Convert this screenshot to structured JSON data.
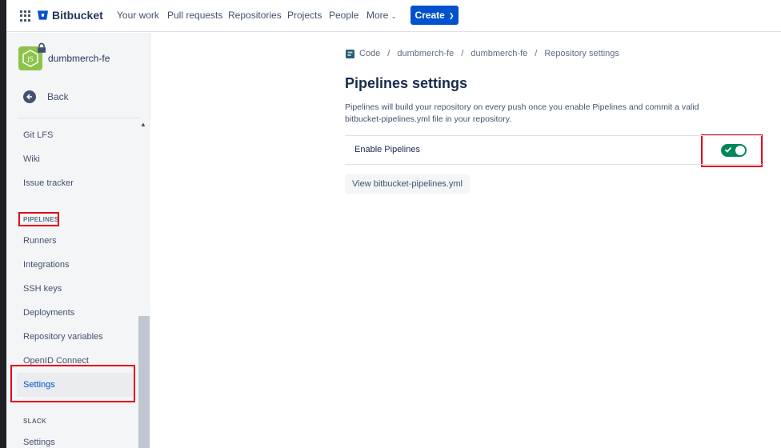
{
  "topnav": {
    "app_name": "Bitbucket",
    "items": [
      "Your work",
      "Pull requests",
      "Repositories",
      "Projects",
      "People",
      "More"
    ],
    "create_label": "Create",
    "brand_color": "#0052cc"
  },
  "sidebar": {
    "repo_name": "dumbmerch-fe",
    "back_label": "Back",
    "items_top": [
      "Git LFS",
      "Wiki",
      "Issue tracker"
    ],
    "section_pipelines": "PIPELINES",
    "pipeline_items": [
      "Runners",
      "Integrations",
      "SSH keys",
      "Deployments",
      "Repository variables",
      "OpenID Connect",
      "Settings"
    ],
    "section_slack": "SLACK",
    "slack_items": [
      "Settings"
    ]
  },
  "breadcrumb": {
    "items": [
      "Code",
      "dumbmerch-fe",
      "dumbmerch-fe",
      "Repository settings"
    ],
    "separator": "/"
  },
  "main": {
    "title": "Pipelines settings",
    "description": "Pipelines will build your repository on every push once you enable Pipelines and commit a valid bitbucket-pipelines.yml file in your repository.",
    "enable_label": "Enable Pipelines",
    "enable_state": true,
    "view_button": "View bitbucket-pipelines.yml",
    "toggle_color": "#00875a"
  },
  "annotations": {
    "highlight_color": "#e2001a"
  }
}
